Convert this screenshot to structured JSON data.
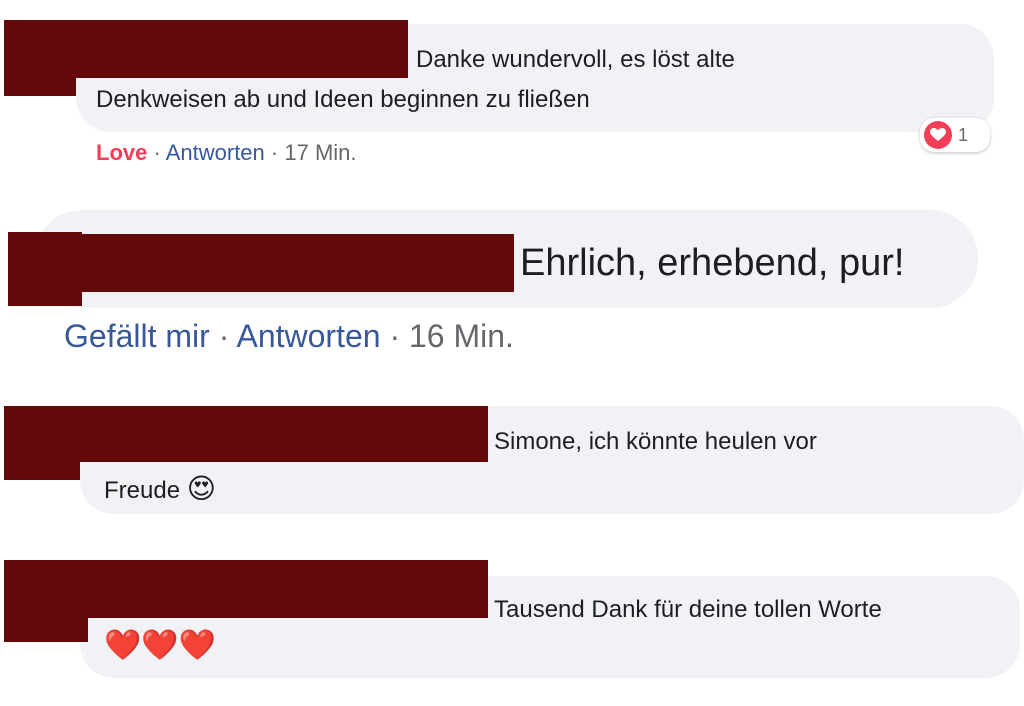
{
  "comments": [
    {
      "text_line1": "Danke wundervoll, es löst alte",
      "text_line2": "Denkweisen ab und Ideen beginnen zu fließen",
      "action_reaction": "Love",
      "action_reply": "Antworten",
      "time": "17 Min.",
      "reaction_count": "1",
      "reaction_icon": "heart-icon"
    },
    {
      "text_line1": "Ehrlich, erhebend, pur!",
      "action_like": "Gefällt mir",
      "action_reply": "Antworten",
      "time": "16 Min."
    },
    {
      "text_line1": "Simone, ich könnte heulen vor",
      "text_line2": "Freude",
      "emoji": "😍",
      "emoji_name": "heart-eyes-icon"
    },
    {
      "text_line1": "Tausend Dank für deine tollen Worte",
      "emoji": "❤️❤️❤️",
      "emoji_name": "red-hearts-icon"
    }
  ],
  "separator": "·",
  "colors": {
    "bubble": "#f0f2f5",
    "redaction": "#630909",
    "link": "#385898",
    "love": "#f33e58",
    "meta": "#65676b"
  }
}
